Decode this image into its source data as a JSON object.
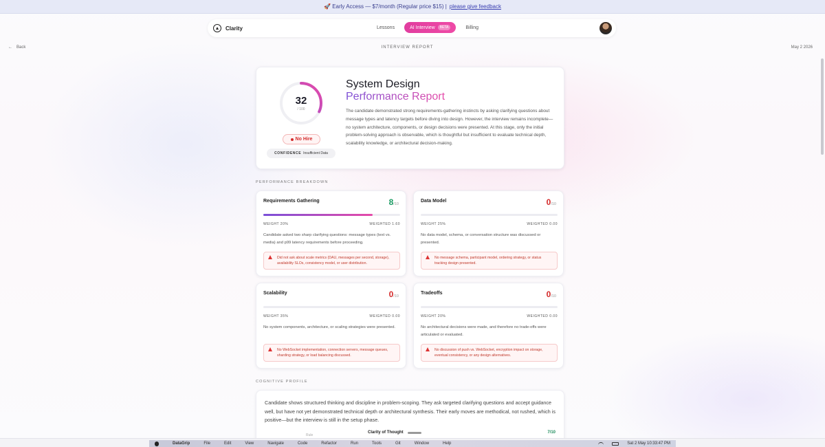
{
  "banner": {
    "text": "🚀 Early Access — $7/month (Regular price $15) |",
    "link": "please give feedback"
  },
  "nav": {
    "brand": "Clarity",
    "tabs": [
      {
        "label": "Lessons"
      },
      {
        "label": "AI Interview",
        "badge": "BETA"
      },
      {
        "label": "Billing"
      }
    ]
  },
  "subheader": {
    "back": "Back",
    "title": "Interview Report",
    "date": "May 2 2026"
  },
  "report": {
    "score": "32",
    "score_max": "/ 100",
    "score_value": 32,
    "title": "System Design",
    "subtitle": "Performance Report",
    "description": "The candidate demonstrated strong requirements-gathering instincts by asking clarifying questions about message types and latency targets before diving into design. However, the interview remains incomplete—no system architecture, components, or design decisions were presented. At this stage, only the initial problem-solving approach is observable, which is thoughtful but insufficient to evaluate technical depth, scalability knowledge, or architectural decision-making.",
    "verdict": "No Hire",
    "confidence_label": "CONFIDENCE",
    "confidence_value": "Insufficient Data"
  },
  "breakdown": {
    "label": "Performance Breakdown",
    "metrics": [
      {
        "title": "Requirements Gathering",
        "score": "8",
        "den": "/10",
        "score_value": 8,
        "color": "#1a9a62",
        "weight": "WEIGHT 20%",
        "weighted": "WEIGHTED 1.60",
        "description": "Candidate asked two sharp clarifying questions: message types (text vs. media) and p99 latency requirements before proceeding.",
        "alert": "Did not ask about scale metrics (DAU, messages per second, storage), availability SLOs, consistency model, or user distribution."
      },
      {
        "title": "Data Model",
        "score": "0",
        "den": "/10",
        "score_value": 0,
        "color": "#d42a2a",
        "weight": "WEIGHT 25%",
        "weighted": "WEIGHTED 0.00",
        "description": "No data model, schema, or conversation structure was discussed or presented.",
        "alert": "No message schema, participant model, ordering strategy, or status tracking design presented."
      },
      {
        "title": "Scalability",
        "score": "0",
        "den": "/10",
        "score_value": 0,
        "color": "#d42a2a",
        "weight": "WEIGHT 35%",
        "weighted": "WEIGHTED 0.00",
        "description": "No system components, architecture, or scaling strategies were presented.",
        "alert": "No WebSocket implementation, connection servers, message queues, sharding strategy, or load balancing discussed."
      },
      {
        "title": "Tradeoffs",
        "score": "0",
        "den": "/10",
        "score_value": 0,
        "color": "#d42a2a",
        "weight": "WEIGHT 20%",
        "weighted": "WEIGHTED 0.00",
        "description": "No architectural decisions were made, and therefore no trade-offs were articulated or evaluated.",
        "alert": "No discussion of push vs. WebSocket, encryption impact on storage, eventual consistency, or any design alternatives."
      }
    ]
  },
  "cognitive": {
    "label": "Cognitive Profile",
    "text": "Candidate shows structured thinking and discipline in problem-scoping. They ask targeted clarifying questions and accept guidance well, but have not yet demonstrated technical depth or architectural synthesis. Their early moves are methodical, not rushed, which is positive—but the interview is still in the setup phase.",
    "sub_label": "Clarity of Thought",
    "sub_score": "7/10",
    "side_label": "Rule"
  },
  "dock": {
    "app": "DataGrip",
    "menus": [
      "File",
      "Edit",
      "View",
      "Navigate",
      "Code",
      "Refactor",
      "Run",
      "Tools",
      "Git",
      "Window",
      "Help"
    ],
    "clock": "Sat 2 May  10:33:47 PM"
  }
}
